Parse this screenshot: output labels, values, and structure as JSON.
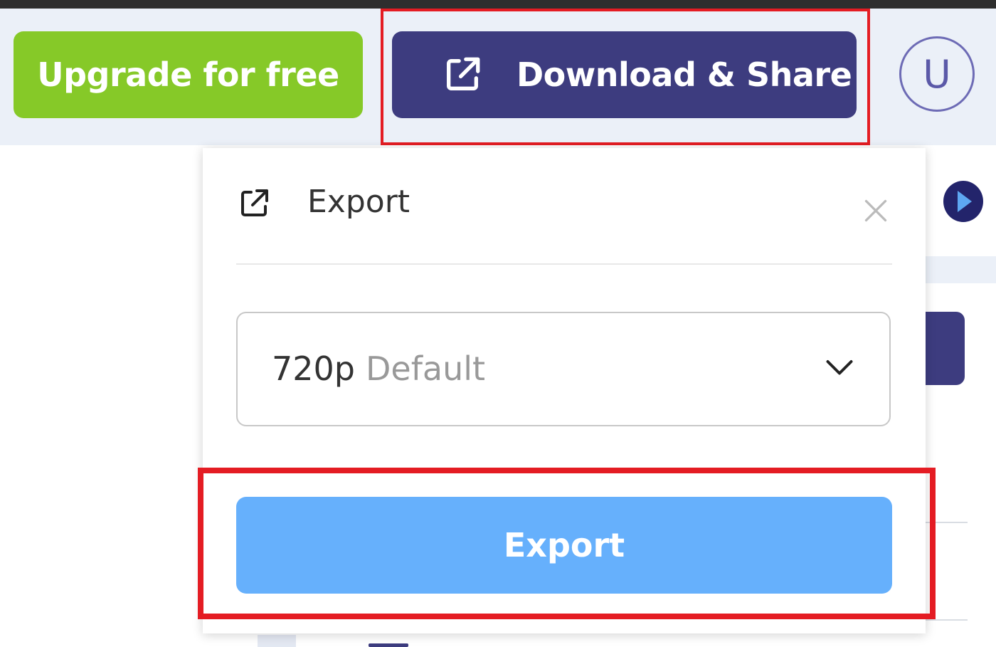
{
  "header": {
    "upgrade_label": "Upgrade for free",
    "download_label": "Download & Share",
    "avatar_initial": "U"
  },
  "export_popup": {
    "title": "Export",
    "resolution": {
      "value": "720p",
      "note": "Default"
    },
    "export_button_label": "Export"
  },
  "colors": {
    "upgrade_green": "#86c928",
    "primary_navy": "#3d3c7f",
    "export_blue": "#66b0fc",
    "highlight_red": "#e41c23"
  },
  "icons": [
    "external-link-icon",
    "close-icon",
    "chevron-down-icon",
    "play-icon"
  ]
}
